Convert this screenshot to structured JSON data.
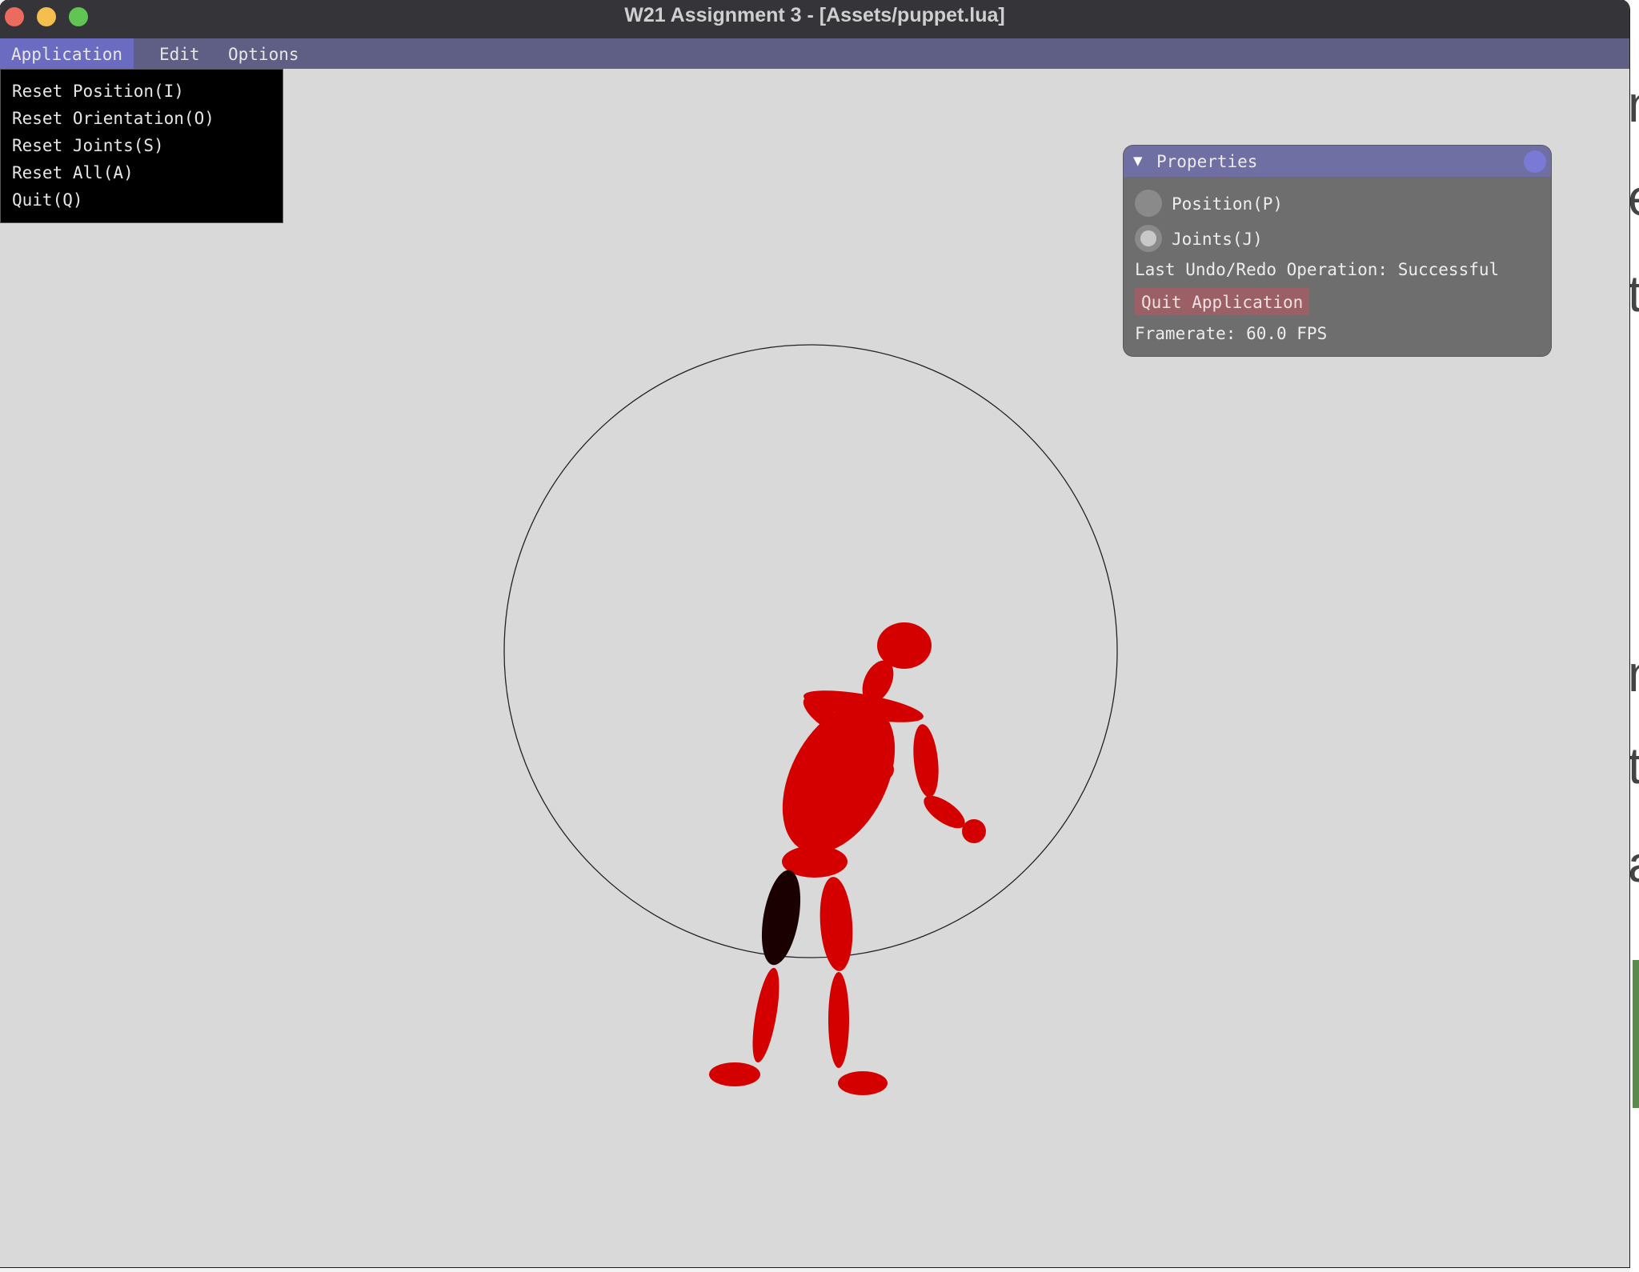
{
  "window": {
    "title": "W21 Assignment 3 - [Assets/puppet.lua]"
  },
  "menubar": {
    "items": [
      {
        "label": "Application",
        "active": true
      },
      {
        "label": "Edit",
        "active": false
      },
      {
        "label": "Options",
        "active": false
      }
    ]
  },
  "dropdown": {
    "items": [
      {
        "label": "Reset Position(I)"
      },
      {
        "label": "Reset Orientation(O)"
      },
      {
        "label": "Reset Joints(S)"
      },
      {
        "label": "Reset All(A)"
      },
      {
        "label": "Quit(Q)"
      }
    ]
  },
  "properties": {
    "title": "Properties",
    "mode_options": [
      {
        "label": "Position(P)",
        "selected": false
      },
      {
        "label": "Joints(J)",
        "selected": true
      }
    ],
    "status": "Last Undo/Redo Operation: Successful",
    "quit_label": "Quit Application",
    "framerate": "Framerate: 60.0 FPS"
  },
  "colors": {
    "puppet_red": "#d40000",
    "selected_part": "#1a0000",
    "menubar": "#5f5f86",
    "menu_active": "#6b6bc1",
    "panel_header": "#6f6fa3",
    "quit_button": "#9b6066"
  }
}
